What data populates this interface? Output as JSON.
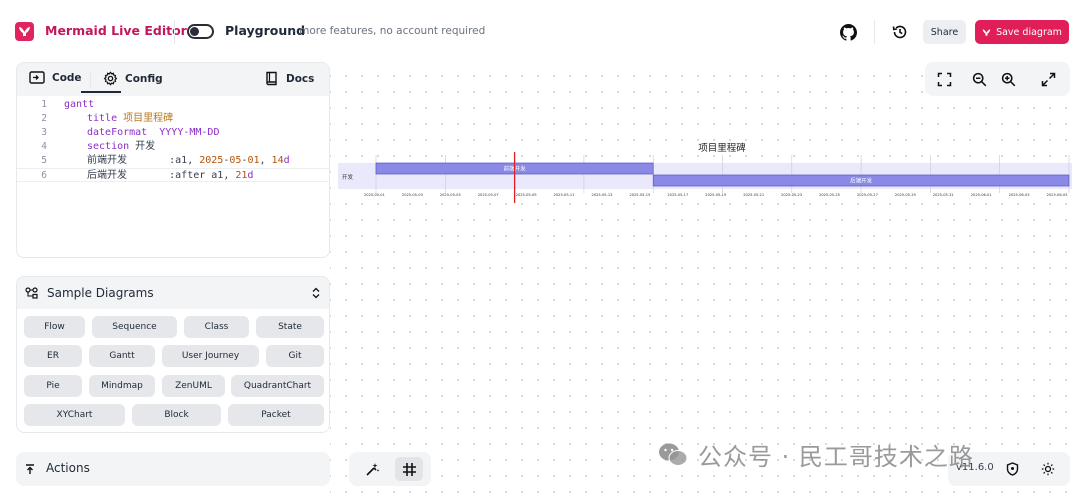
{
  "header": {
    "app_title": "Mermaid Live Editor",
    "playground_label": "Playground",
    "playground_sub": "- more features, no account required",
    "share_label": "Share",
    "save_label": "Save diagram"
  },
  "editor": {
    "tabs": [
      {
        "label": "Code",
        "icon": "code-icon"
      },
      {
        "label": "Config",
        "icon": "gear-icon"
      }
    ],
    "docs_label": "Docs",
    "lines": [
      {
        "n": "1",
        "text": "gantt"
      },
      {
        "n": "2",
        "kw": "title",
        "rest": " 项目里程碑"
      },
      {
        "n": "3",
        "kw": "dateFormat",
        "rest": "  YYYY-MM-DD"
      },
      {
        "n": "4",
        "kw": "section",
        "rest": " 开发"
      },
      {
        "n": "5",
        "name": "前端开发",
        "p1": "       :a1, ",
        "p2": "2025",
        "p3": "-",
        "p4": "05",
        "p5": "-",
        "p6": "01",
        "p7": ", ",
        "p8": "14",
        "p9": "d"
      },
      {
        "n": "6",
        "name": "后端开发",
        "p1": "       :after a1, ",
        "p2": "21",
        "p3": "d"
      }
    ]
  },
  "samples": {
    "title": "Sample Diagrams",
    "buttons": [
      "Flow",
      "Sequence",
      "Class",
      "State",
      "ER",
      "Gantt",
      "User Journey",
      "Git",
      "Pie",
      "Mindmap",
      "ZenUML",
      "QuadrantChart",
      "XYChart",
      "Block",
      "Packet"
    ]
  },
  "actions": {
    "title": "Actions"
  },
  "footer": {
    "version": "v11.6.0"
  },
  "watermark": "公众号 · 民工哥技术之路",
  "gantt": {
    "title": "项目里程碑",
    "section": "开发",
    "tasks": [
      {
        "name": "前端开发",
        "start": "2025-05-01",
        "days": 14
      },
      {
        "name": "后端开发",
        "start": "2025-05-15",
        "days": 21
      }
    ],
    "ticks": [
      "2025-05-01",
      "2025-05-03",
      "2025-05-05",
      "2025-05-07",
      "2025-05-09",
      "2025-05-11",
      "2025-05-13",
      "2025-05-15",
      "2025-05-17",
      "2025-05-19",
      "2025-05-21",
      "2025-05-23",
      "2025-05-25",
      "2025-05-27",
      "2025-05-29",
      "2025-05-31",
      "2025-06-01",
      "2025-06-03",
      "2025-06-05"
    ],
    "today": "2025-05-08",
    "colors": {
      "bar": "#8a8ae6",
      "bar_border": "#5353c9",
      "section_bg": "#e9e9fb",
      "today": "#e02020"
    }
  }
}
